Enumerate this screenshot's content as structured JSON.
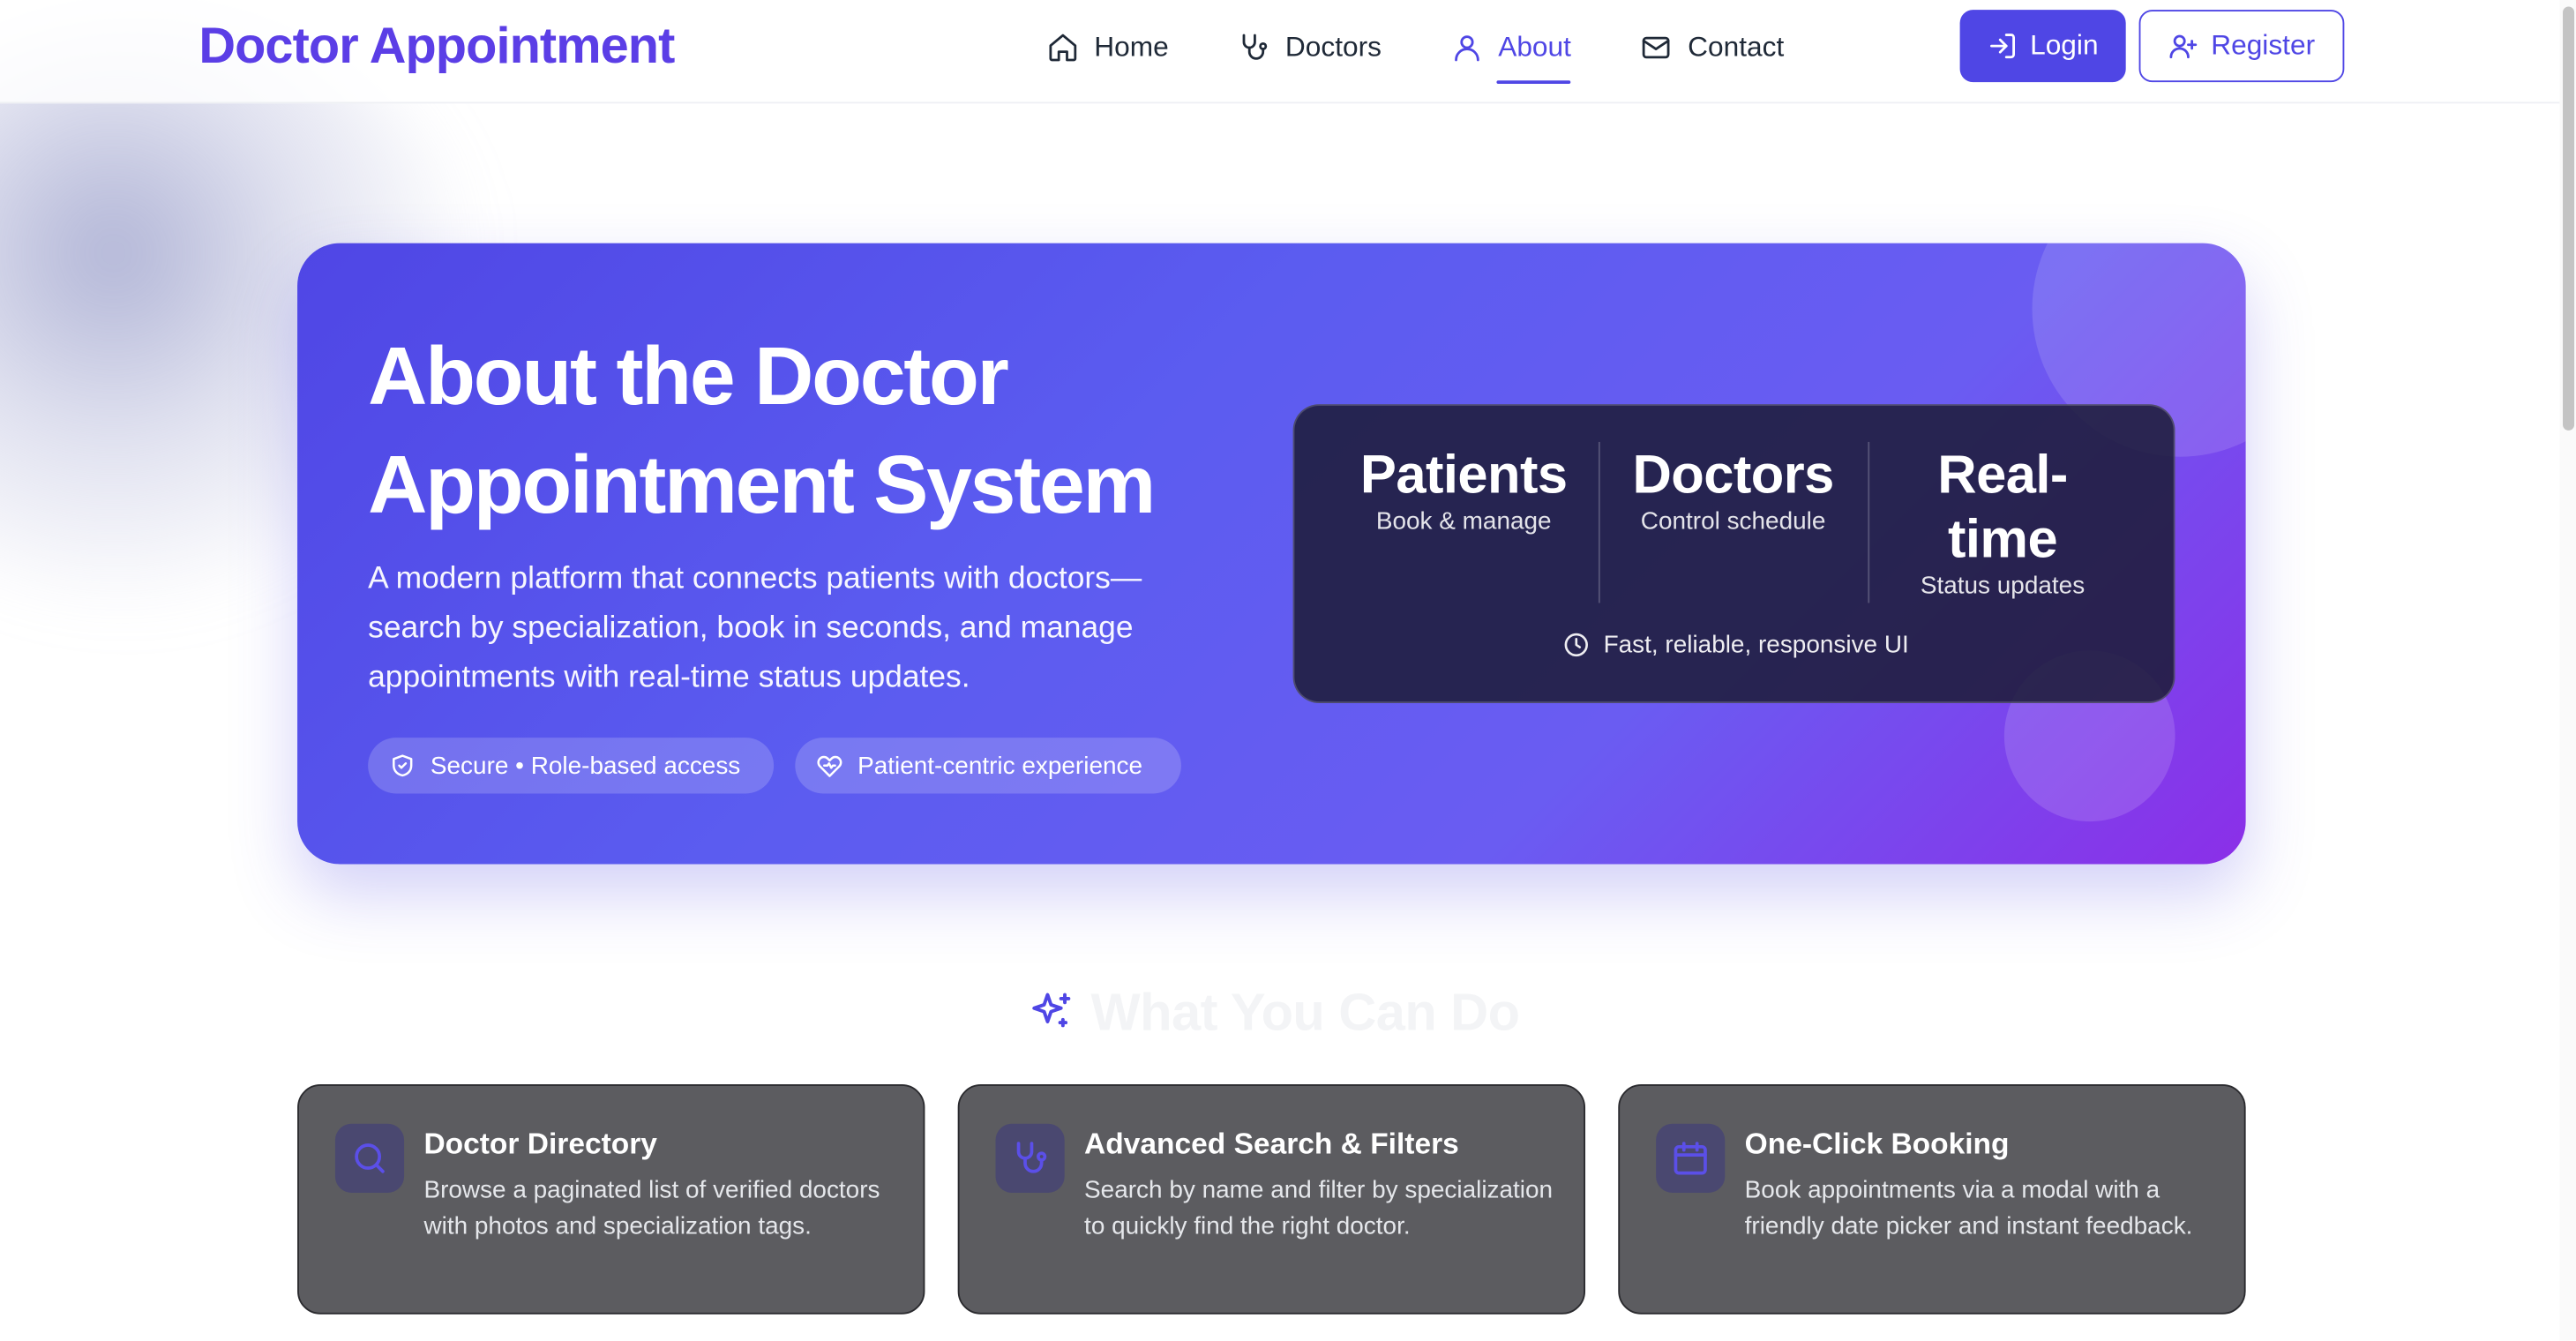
{
  "brand": "Doctor Appointment",
  "nav": {
    "items": [
      {
        "label": "Home",
        "icon": "home-icon"
      },
      {
        "label": "Doctors",
        "icon": "stethoscope-icon"
      },
      {
        "label": "About",
        "icon": "user-icon",
        "active": true
      },
      {
        "label": "Contact",
        "icon": "mail-icon"
      }
    ],
    "login_label": "Login",
    "register_label": "Register"
  },
  "hero": {
    "title": "About the Doctor Appointment System",
    "description": "A modern platform that connects patients with doctors—search by specialization, book in seconds, and manage appointments with real-time status updates.",
    "pills": [
      {
        "label": "Secure • Role-based access",
        "icon": "shield-check-icon"
      },
      {
        "label": "Patient-centric experience",
        "icon": "heart-pulse-icon"
      }
    ],
    "stats": [
      {
        "title": "Patients",
        "subtitle": "Book & manage"
      },
      {
        "title": "Doctors",
        "subtitle": "Control schedule"
      },
      {
        "title": "Real-time",
        "subtitle": "Status updates"
      }
    ],
    "stats_footer": "Fast, reliable, responsive UI"
  },
  "features_section": {
    "title": "What You Can Do",
    "icon": "sparkles-icon",
    "cards": [
      {
        "title": "Doctor Directory",
        "description": "Browse a paginated list of verified doctors with photos and specialization tags.",
        "icon": "search-icon"
      },
      {
        "title": "Advanced Search & Filters",
        "description": "Search by name and filter by specialization to quickly find the right doctor.",
        "icon": "stethoscope-icon"
      },
      {
        "title": "One-Click Booking",
        "description": "Book appointments via a modal with a friendly date picker and instant feedback.",
        "icon": "calendar-icon"
      }
    ]
  },
  "colors": {
    "brand": "#5b3ee6",
    "primary": "#4f46e5",
    "hero_gradient_end": "#8b2fe8"
  }
}
